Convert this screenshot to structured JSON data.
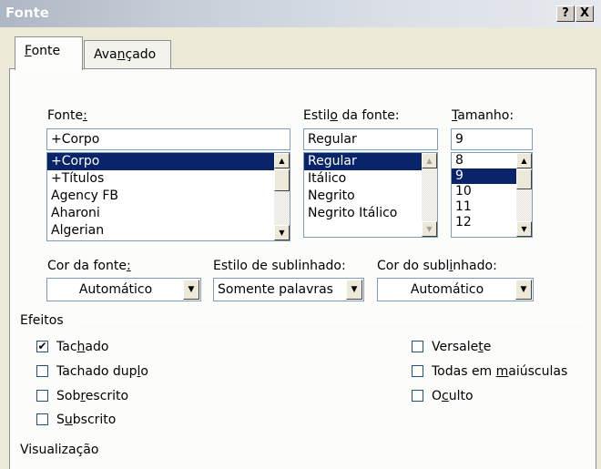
{
  "window": {
    "title": "Fonte",
    "help_label": "?",
    "close_label": "X"
  },
  "tabs": [
    {
      "label": "Fonte",
      "mnemonic_prefix": "",
      "mnemonic": "F",
      "rest": "onte"
    },
    {
      "label": "Avançado",
      "mnemonic_prefix": "Ava",
      "mnemonic": "n",
      "rest": "çado"
    }
  ],
  "font": {
    "label_prefix": "Fonte",
    "label_mnemonic": ":",
    "label": "Fonte:",
    "value": "+Corpo",
    "items": [
      "+Corpo",
      "+Títulos",
      "Agency FB",
      "Aharoni",
      "Algerian"
    ],
    "selected": "+Corpo"
  },
  "style": {
    "label_prefix": "Estil",
    "label_mnemonic": "o",
    "label_suffix": " da fonte:",
    "value": "Regular",
    "items": [
      "Regular",
      "Itálico",
      "Negrito",
      "Negrito Itálico"
    ],
    "selected": "Regular"
  },
  "size": {
    "label_mnemonic": "T",
    "label_suffix": "amanho:",
    "value": "9",
    "items": [
      "8",
      "9",
      "10",
      "11",
      "12"
    ],
    "selected": "9"
  },
  "font_color": {
    "label_prefix": "Cor da fonte",
    "label_mnemonic": ":",
    "value": "Automático"
  },
  "underline_style": {
    "label_prefix": "Estilo de sublinhado:",
    "value": "Somente palavras"
  },
  "underline_color": {
    "label_prefix": "Cor do subl",
    "label_mnemonic": "i",
    "label_suffix": "nhado:",
    "value": "Automático"
  },
  "effects": {
    "title": "Efeitos",
    "left": [
      {
        "pre": "Tac",
        "mn": "h",
        "post": "ado",
        "checked": true,
        "check_mark": "✔"
      },
      {
        "pre": "Tachado dup",
        "mn": "l",
        "post": "o",
        "checked": false,
        "check_mark": ""
      },
      {
        "pre": "Sob",
        "mn": "r",
        "post": "escrito",
        "checked": false,
        "check_mark": ""
      },
      {
        "pre": "S",
        "mn": "u",
        "post": "bscrito",
        "checked": false,
        "check_mark": ""
      }
    ],
    "right": [
      {
        "pre": "Versale",
        "mn": "t",
        "post": "e",
        "checked": false,
        "check_mark": ""
      },
      {
        "pre": "Todas em ",
        "mn": "m",
        "post": "aiúsculas",
        "checked": false,
        "check_mark": ""
      },
      {
        "pre": "O",
        "mn": "c",
        "post": "ulto",
        "checked": false,
        "check_mark": ""
      }
    ]
  },
  "preview": {
    "title": "Visualização"
  }
}
